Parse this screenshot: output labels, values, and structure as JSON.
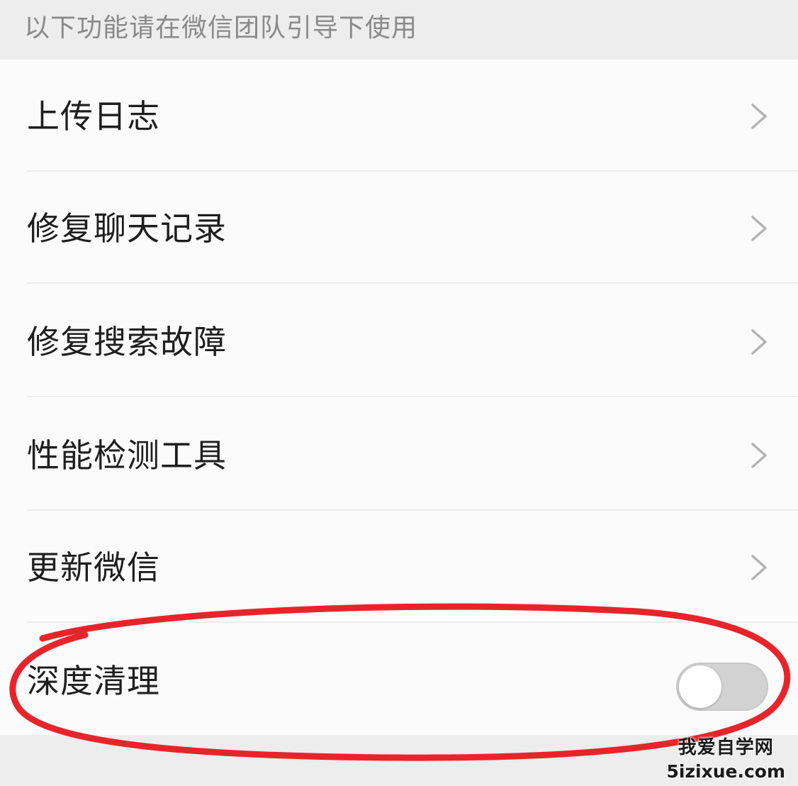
{
  "section_header": "以下功能请在微信团队引导下使用",
  "items": [
    {
      "label": "上传日志",
      "control": "chevron"
    },
    {
      "label": "修复聊天记录",
      "control": "chevron"
    },
    {
      "label": "修复搜索故障",
      "control": "chevron"
    },
    {
      "label": "性能检测工具",
      "control": "chevron"
    },
    {
      "label": "更新微信",
      "control": "chevron"
    },
    {
      "label": "深度清理",
      "control": "toggle",
      "toggle_on": false
    }
  ],
  "annotation": {
    "shape": "ellipse",
    "color": "#e8242b",
    "target": "深度清理"
  },
  "watermark": {
    "name": "我爱自学网",
    "url": "5izixue.com"
  },
  "colors": {
    "background": "#ededed",
    "list_background": "#fbfbfb",
    "text": "#1e1e1e",
    "header_text": "#8a8a8a"
  }
}
